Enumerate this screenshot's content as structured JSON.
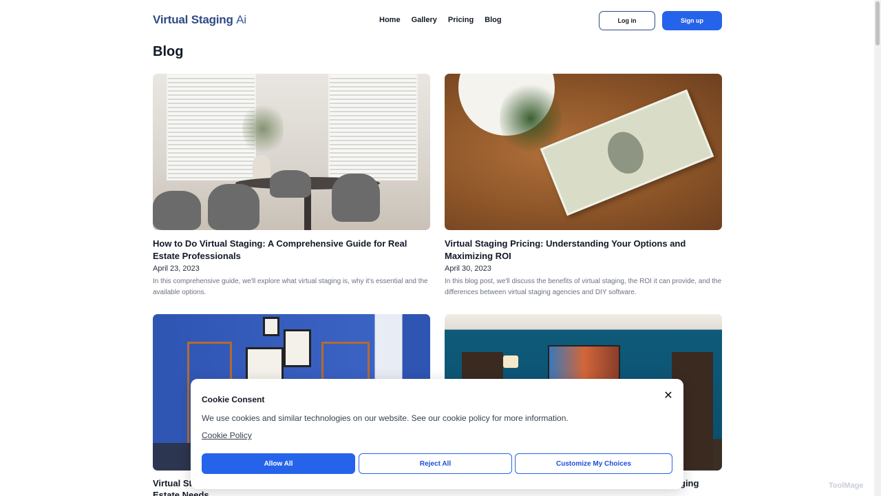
{
  "header": {
    "logo_main": "Virtual Staging ",
    "logo_ai": "Ai",
    "nav": [
      "Home",
      "Gallery",
      "Pricing",
      "Blog"
    ],
    "login_label": "Log in",
    "signup_label": "Sign up"
  },
  "page_title": "Blog",
  "posts": [
    {
      "title": "How to Do Virtual Staging: A Comprehensive Guide for Real Estate Professionals",
      "date": "April 23, 2023",
      "excerpt": "In this comprehensive guide, we'll explore what virtual staging is, why it's essential and the available options."
    },
    {
      "title": "Virtual Staging Pricing: Understanding Your Options and Maximizing ROI",
      "date": "April 30, 2023",
      "excerpt": "In this blog post, we'll discuss the benefits of virtual staging, the ROI it can provide, and the differences between virtual staging agencies and DIY software."
    },
    {
      "title_visible_left": "Virtual St",
      "title_visible_left2": "Estate Needs"
    },
    {
      "title_visible_right": "ging"
    }
  ],
  "cookie": {
    "title": "Cookie Consent",
    "text": "We use cookies and similar technologies on our website. See our cookie policy for more information.",
    "policy_link": "Cookie Policy",
    "allow_label": "Allow All",
    "reject_label": "Reject All",
    "customize_label": "Customize My Choices"
  },
  "watermark": "ToolMage",
  "colors": {
    "brand": "#2f4a86",
    "primary_button": "#2563eb"
  }
}
